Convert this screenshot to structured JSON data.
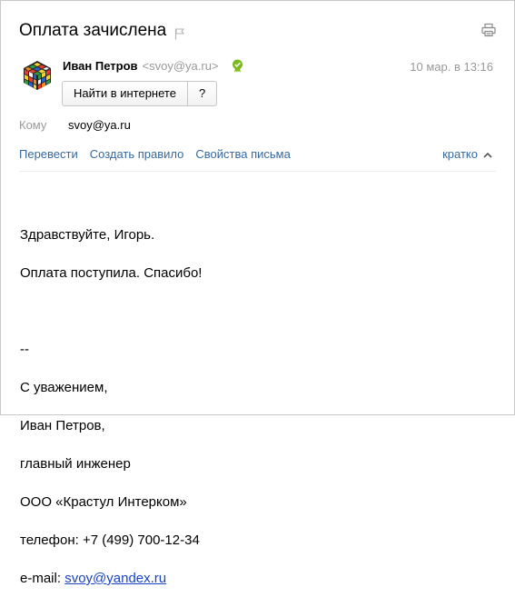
{
  "message": {
    "subject": "Оплата зачислена",
    "sender": {
      "name": "Иван Петров",
      "email": "<svoy@ya.ru>"
    },
    "date": "10 мар. в 13:16",
    "buttons": {
      "search_label": "Найти в интернете",
      "help_label": "?"
    },
    "to": {
      "label": "Кому",
      "value": "svoy@ya.ru"
    },
    "actions": [
      {
        "label": "Перевести"
      },
      {
        "label": "Создать правило"
      },
      {
        "label": "Свойства письма"
      }
    ],
    "brief_label": "кратко",
    "body": {
      "line1": "Здравствуйте, Игорь.",
      "line2": "Оплата поступила. Спасибо!",
      "sig_dash": "--",
      "sig_regards": "С уважением,",
      "sig_name": "Иван Петров,",
      "sig_title": "главный инженер",
      "sig_company": "ООО «Крастул Интерком»",
      "sig_phone": "телефон: +7 (499) 700-12-34",
      "sig_email_prefix": "e-mail: ",
      "sig_email_link": "svoy@yandex.ru"
    }
  },
  "colors": {
    "link": "#36699f",
    "muted": "#999999",
    "verified": "#7ab81e"
  },
  "icons": {
    "flag": "flag-icon",
    "print": "print-icon",
    "verified": "verified-badge-icon",
    "collapse": "chevron-up-icon",
    "avatar": "rubiks-cube-avatar"
  }
}
